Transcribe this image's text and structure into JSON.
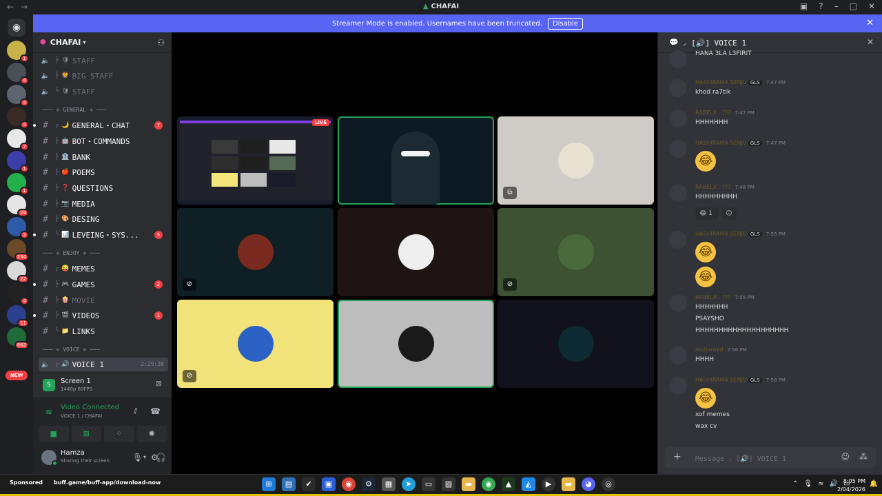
{
  "window": {
    "title": "CHAFAI"
  },
  "banner": {
    "text": "Streamer Mode is enabled. Usernames have been truncated.",
    "button": "Disable"
  },
  "rail": {
    "servers": [
      {
        "badge": "1",
        "color": "#c9b24a"
      },
      {
        "badge": "4",
        "color": "#4a4f58"
      },
      {
        "badge": "4",
        "color": "#5d6470"
      },
      {
        "badge": "4",
        "color": "#3a2c24"
      },
      {
        "badge": "7",
        "color": "#e8e8e8"
      },
      {
        "badge": "1",
        "color": "#3b3ea8"
      },
      {
        "badge": "1",
        "color": "#22b14c"
      },
      {
        "badge": "29",
        "color": "#e5e5e5"
      },
      {
        "badge": "2",
        "color": "#2e5aa8"
      },
      {
        "badge": "234",
        "color": "#6b4a2a"
      },
      {
        "badge": "22",
        "color": "#d9d9d9"
      },
      {
        "badge": "4",
        "color": "#222222"
      },
      {
        "badge": "11",
        "color": "#2b3f8f"
      },
      {
        "badge": "882",
        "color": "#1f6b3a"
      }
    ],
    "new_label": "NEW"
  },
  "sidebar": {
    "guild_name": "CHAFAI",
    "channels": [
      {
        "kind": "voice",
        "tree": "├",
        "emo": "🛡",
        "name": "STAFF",
        "state": "dim",
        "badge": ""
      },
      {
        "kind": "voice",
        "tree": "├",
        "emo": "🦁",
        "name": "BIG STAFF",
        "state": "dim",
        "badge": ""
      },
      {
        "kind": "voice",
        "tree": "└",
        "emo": "🛡",
        "name": "STAFF",
        "state": "dim",
        "badge": ""
      },
      {
        "kind": "category",
        "name": "─── ⟡ GENERAL ⟡ ───"
      },
      {
        "kind": "text",
        "tree": "┌",
        "emo": "🌙",
        "name": "GENERAL・CHAT",
        "state": "unread",
        "badge": "7"
      },
      {
        "kind": "text",
        "tree": "├",
        "emo": "🤖",
        "name": "BOT・COMMANDS",
        "state": "unread",
        "badge": ""
      },
      {
        "kind": "text",
        "tree": "├",
        "emo": "🏦",
        "name": "BANK",
        "state": "unread",
        "badge": ""
      },
      {
        "kind": "text",
        "tree": "├",
        "emo": "🍎",
        "name": "POEMS",
        "state": "unread",
        "badge": ""
      },
      {
        "kind": "text",
        "tree": "├",
        "emo": "❓",
        "name": "QUESTIONS",
        "state": "unread",
        "badge": ""
      },
      {
        "kind": "text",
        "tree": "├",
        "emo": "📷",
        "name": "MEDIA",
        "state": "unread",
        "badge": ""
      },
      {
        "kind": "text",
        "tree": "├",
        "emo": "🎨",
        "name": "DESING",
        "state": "unread",
        "badge": ""
      },
      {
        "kind": "text",
        "tree": "└",
        "emo": "📊",
        "name": "LEVEING・SYS...",
        "state": "unread",
        "badge": "5"
      },
      {
        "kind": "category",
        "name": "─── ⟡ ENJOY ⟡ ───"
      },
      {
        "kind": "text",
        "tree": "┌",
        "emo": "😜",
        "name": "MEMES",
        "state": "unread",
        "badge": ""
      },
      {
        "kind": "text",
        "tree": "├",
        "emo": "🎮",
        "name": "GAMES",
        "state": "unread",
        "badge": "2"
      },
      {
        "kind": "text",
        "tree": "├",
        "emo": "🍿",
        "name": "MOVIE",
        "state": "dim",
        "badge": ""
      },
      {
        "kind": "text",
        "tree": "├",
        "emo": "🎬",
        "name": "VIDEOS",
        "state": "unread",
        "badge": "1"
      },
      {
        "kind": "text",
        "tree": "└",
        "emo": "📁",
        "name": "LINKS",
        "state": "unread",
        "badge": ""
      },
      {
        "kind": "category",
        "name": "─── ⟡ VOICE ⟡ ───"
      },
      {
        "kind": "voice-active",
        "tree": "┌",
        "emo": "🔊",
        "name": "VOICE 1",
        "state": "selected",
        "timer": "2:29:38"
      }
    ],
    "screen_panel": {
      "title": "Screen 1",
      "sub": "1440p 60FPS"
    },
    "voice_panel": {
      "status": "Video Connected",
      "channel": "VOICE 1 / CHAFAI"
    },
    "user": {
      "name": "Hamza",
      "status": "Sharing their screen"
    }
  },
  "stage": {
    "live_label": "LIVE",
    "tiles": [
      {
        "bg": "#1a1a2e",
        "avatar": "#2a2a2a",
        "kind": "stream",
        "muted": false,
        "speaking": false
      },
      {
        "bg": "#0d1a24",
        "avatar": "#1c2a33",
        "kind": "camera",
        "muted": false,
        "speaking": true
      },
      {
        "bg": "#cfccc7",
        "avatar": "#e8e1d2",
        "kind": "avatar",
        "muted": false,
        "speaking": false,
        "corner_icon": "screen-share-icon"
      },
      {
        "bg": "#0f1f26",
        "avatar": "#7a2a1e",
        "kind": "avatar",
        "muted": true,
        "speaking": false
      },
      {
        "bg": "#1e1414",
        "avatar": "#eeeeee",
        "kind": "avatar",
        "muted": false,
        "speaking": false
      },
      {
        "bg": "#3d5233",
        "avatar": "#4a6a3c",
        "kind": "avatar",
        "muted": true,
        "speaking": false
      },
      {
        "bg": "#f2e27a",
        "avatar": "#2b62c4",
        "kind": "avatar",
        "muted": true,
        "speaking": false
      },
      {
        "bg": "#bdbdbd",
        "avatar": "#1a1a1a",
        "kind": "avatar",
        "muted": false,
        "speaking": true
      },
      {
        "bg": "#12121c",
        "avatar": "#0e2a33",
        "kind": "avatar",
        "muted": false,
        "speaking": false
      }
    ]
  },
  "chat": {
    "header": "⸝ [🔊] VOICE 1",
    "composer_placeholder": "Message ⸝ [🔊] VOICE 1",
    "messages": [
      {
        "name": "",
        "tag": "",
        "time": "",
        "lines": [
          "HANA 3LA L3FIRIT"
        ],
        "emoji": 0,
        "reaction": false
      },
      {
        "name": "HASHIRAMA SENJU",
        "tag": "GLS",
        "time": "7:47 PM",
        "lines": [
          "khod ra7tik"
        ],
        "emoji": 0,
        "reaction": false
      },
      {
        "name": "RABELX . ???",
        "tag": "",
        "time": "7:47 PM",
        "lines": [
          "HHHHHHH"
        ],
        "emoji": 0,
        "reaction": false
      },
      {
        "name": "HASHIRAMA SENJU",
        "tag": "GLS",
        "time": "7:47 PM",
        "lines": [],
        "emoji": 1,
        "reaction": false
      },
      {
        "name": "RABELX . ???",
        "tag": "",
        "time": "7:48 PM",
        "lines": [
          "HHHHHHHHH"
        ],
        "emoji": 0,
        "reaction": true,
        "reaction_count": "1"
      },
      {
        "name": "HASHIRAMA SENJU",
        "tag": "GLS",
        "time": "7:55 PM",
        "lines": [],
        "emoji": 2,
        "reaction": false
      },
      {
        "name": "RABELX . ???",
        "tag": "",
        "time": "7:55 PM",
        "lines": [
          "HHHHHHH",
          "PSAYSHO",
          "HHHHHHHHHHHHHHHHHHHH"
        ],
        "emoji": 0,
        "reaction": false
      },
      {
        "name": "mohamed",
        "tag": "",
        "time": "7:56 PM",
        "lines": [
          "HHHH"
        ],
        "emoji": 0,
        "reaction": false
      },
      {
        "name": "HASHIRAMA SENJU",
        "tag": "GLS",
        "time": "7:58 PM",
        "lines": [
          "xof memes",
          "wax cv"
        ],
        "emoji": 1,
        "reaction": false
      }
    ]
  },
  "taskbar": {
    "sponsored": "Sponsored",
    "url": "buff.game/buff-app/download-now",
    "time": "8:05 PM",
    "date": "2/04/2026"
  }
}
